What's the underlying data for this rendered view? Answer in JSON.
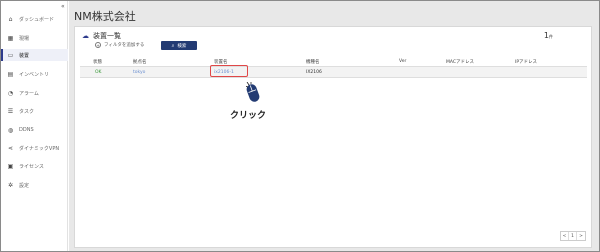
{
  "sidebar": {
    "collapse_glyph": "«",
    "items": [
      {
        "label": "ダッシュボード",
        "icon": "dashboard-icon",
        "glyph": "⌂"
      },
      {
        "label": "現場",
        "icon": "site-icon",
        "glyph": "▦"
      },
      {
        "label": "装置",
        "icon": "device-icon",
        "glyph": "▭"
      },
      {
        "label": "インベントリ",
        "icon": "inventory-icon",
        "glyph": "▤"
      },
      {
        "label": "アラーム",
        "icon": "alarm-icon",
        "glyph": "◔"
      },
      {
        "label": "タスク",
        "icon": "task-icon",
        "glyph": "☰"
      },
      {
        "label": "DDNS",
        "icon": "ddns-icon",
        "glyph": "◍"
      },
      {
        "label": "ダイナミックVPN",
        "icon": "vpn-icon",
        "glyph": "⋖"
      },
      {
        "label": "ライセンス",
        "icon": "license-icon",
        "glyph": "▣"
      },
      {
        "label": "設定",
        "icon": "settings-icon",
        "glyph": "✲"
      }
    ]
  },
  "header": {
    "company": "NM株式会社"
  },
  "card": {
    "title": "装置一覧",
    "title_icon": "cloud-icon",
    "count": "1",
    "count_unit": "件",
    "filter_label": "フィルタを追加する",
    "filter_glyph": "+",
    "search_label": "検索",
    "search_glyph": "⌕"
  },
  "table": {
    "columns": [
      "状態",
      "拠点名",
      "装置名",
      "機種名",
      "Ver",
      "MACアドレス",
      "IPアドレス"
    ],
    "rows": [
      {
        "status": "OK",
        "site": "tokyo",
        "device": "ix2106-1",
        "model": "IX2106",
        "ver": "",
        "mac": "",
        "ip": ""
      }
    ]
  },
  "annotation": {
    "click_label": "クリック"
  },
  "pager": {
    "prev": "<",
    "page": "1",
    "next": ">"
  },
  "colors": {
    "accent": "#233b73",
    "status_ok": "#3a9a3a",
    "highlight": "#e04848"
  }
}
